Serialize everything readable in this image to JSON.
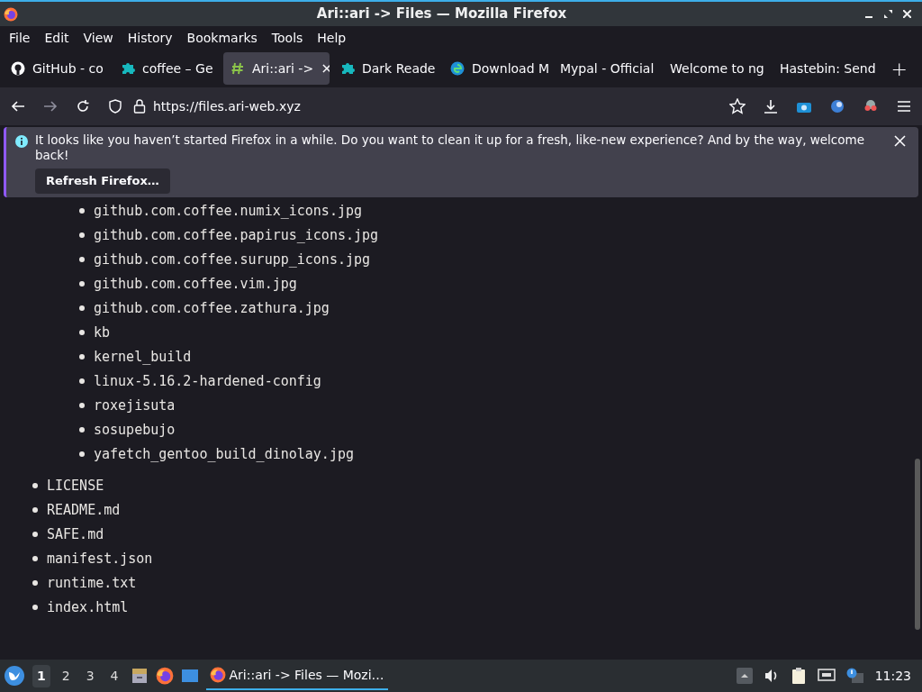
{
  "window": {
    "title": "Ari::ari -> Files — Mozilla Firefox"
  },
  "menu": [
    "File",
    "Edit",
    "View",
    "History",
    "Bookmarks",
    "Tools",
    "Help"
  ],
  "tabs": [
    {
      "label": "GitHub - co",
      "kind": "github",
      "selected": false
    },
    {
      "label": "coffee – Ge",
      "kind": "puzzle",
      "selected": false
    },
    {
      "label": "Ari::ari ->",
      "kind": "hash",
      "selected": true,
      "close": "×"
    },
    {
      "label": "Dark Reade",
      "kind": "puzzle",
      "selected": false
    },
    {
      "label": "Download M",
      "kind": "edge",
      "selected": false
    },
    {
      "label": "Mypal - Official",
      "selected": false
    },
    {
      "label": "Welcome to ng",
      "selected": false
    },
    {
      "label": "Hastebin: Send",
      "selected": false
    }
  ],
  "new_tab": "+",
  "address": {
    "url": "https://files.ari-web.xyz"
  },
  "notification": {
    "message": "It looks like you haven’t started Firefox in a while. Do you want to clean it up for a fresh, like-new experience? And by the way, welcome back!",
    "button": "Refresh Firefox…"
  },
  "listing": {
    "nested": [
      "github.com.coffee.numix_icons.jpg",
      "github.com.coffee.papirus_icons.jpg",
      "github.com.coffee.surupp_icons.jpg",
      "github.com.coffee.vim.jpg",
      "github.com.coffee.zathura.jpg",
      "kb",
      "kernel_build",
      "linux-5.16.2-hardened-config",
      "roxejisuta",
      "sosupebujo",
      "yafetch_gentoo_build_dinolay.jpg"
    ],
    "top": [
      "LICENSE",
      "README.md",
      "SAFE.md",
      "manifest.json",
      "runtime.txt",
      "index.html"
    ]
  },
  "taskbar": {
    "workspaces": [
      {
        "label": "1",
        "selected": true
      },
      {
        "label": "2",
        "selected": false
      },
      {
        "label": "3",
        "selected": false
      },
      {
        "label": "4",
        "selected": false
      }
    ],
    "window_button": {
      "label": "Ari::ari -> Files — Mozi…",
      "selected": true
    },
    "clock": "11:23"
  }
}
